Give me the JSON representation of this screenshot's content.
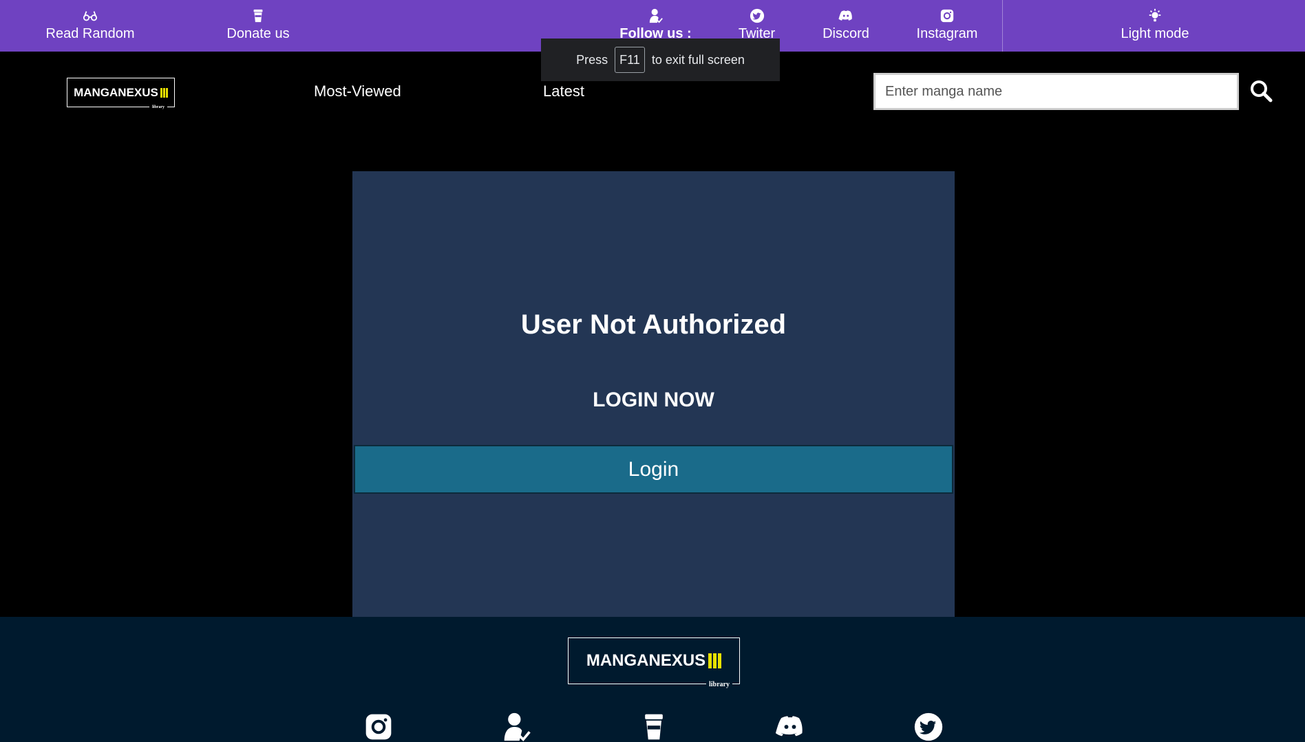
{
  "topbar": {
    "read_random": "Read Random",
    "donate": "Donate us",
    "follow": "Follow us :",
    "twitter": "Twiter",
    "discord": "Discord",
    "instagram": "Instagram",
    "light_mode": "Light mode"
  },
  "toast": {
    "press": "Press",
    "key": "F11",
    "rest": "to exit full screen"
  },
  "header": {
    "logo_text": "MANGANEXUS",
    "logo_sub": "library",
    "nav": [
      "Most-Viewed",
      "Latest"
    ],
    "search_placeholder": "Enter manga name"
  },
  "main": {
    "title": "User Not Authorized",
    "subtitle": "LOGIN NOW",
    "login_button": "Login"
  },
  "footer": {
    "logo_text": "MANGANEXUS",
    "logo_sub": "library",
    "icons": [
      "instagram-icon",
      "user-check-icon",
      "cup-icon",
      "discord-icon",
      "twitter-icon"
    ]
  },
  "colors": {
    "topbar": "#6f42c1",
    "card": "#233654",
    "login_button": "#1a6b8a",
    "footer": "#001a2e",
    "logo_accent": "#e8e100"
  }
}
